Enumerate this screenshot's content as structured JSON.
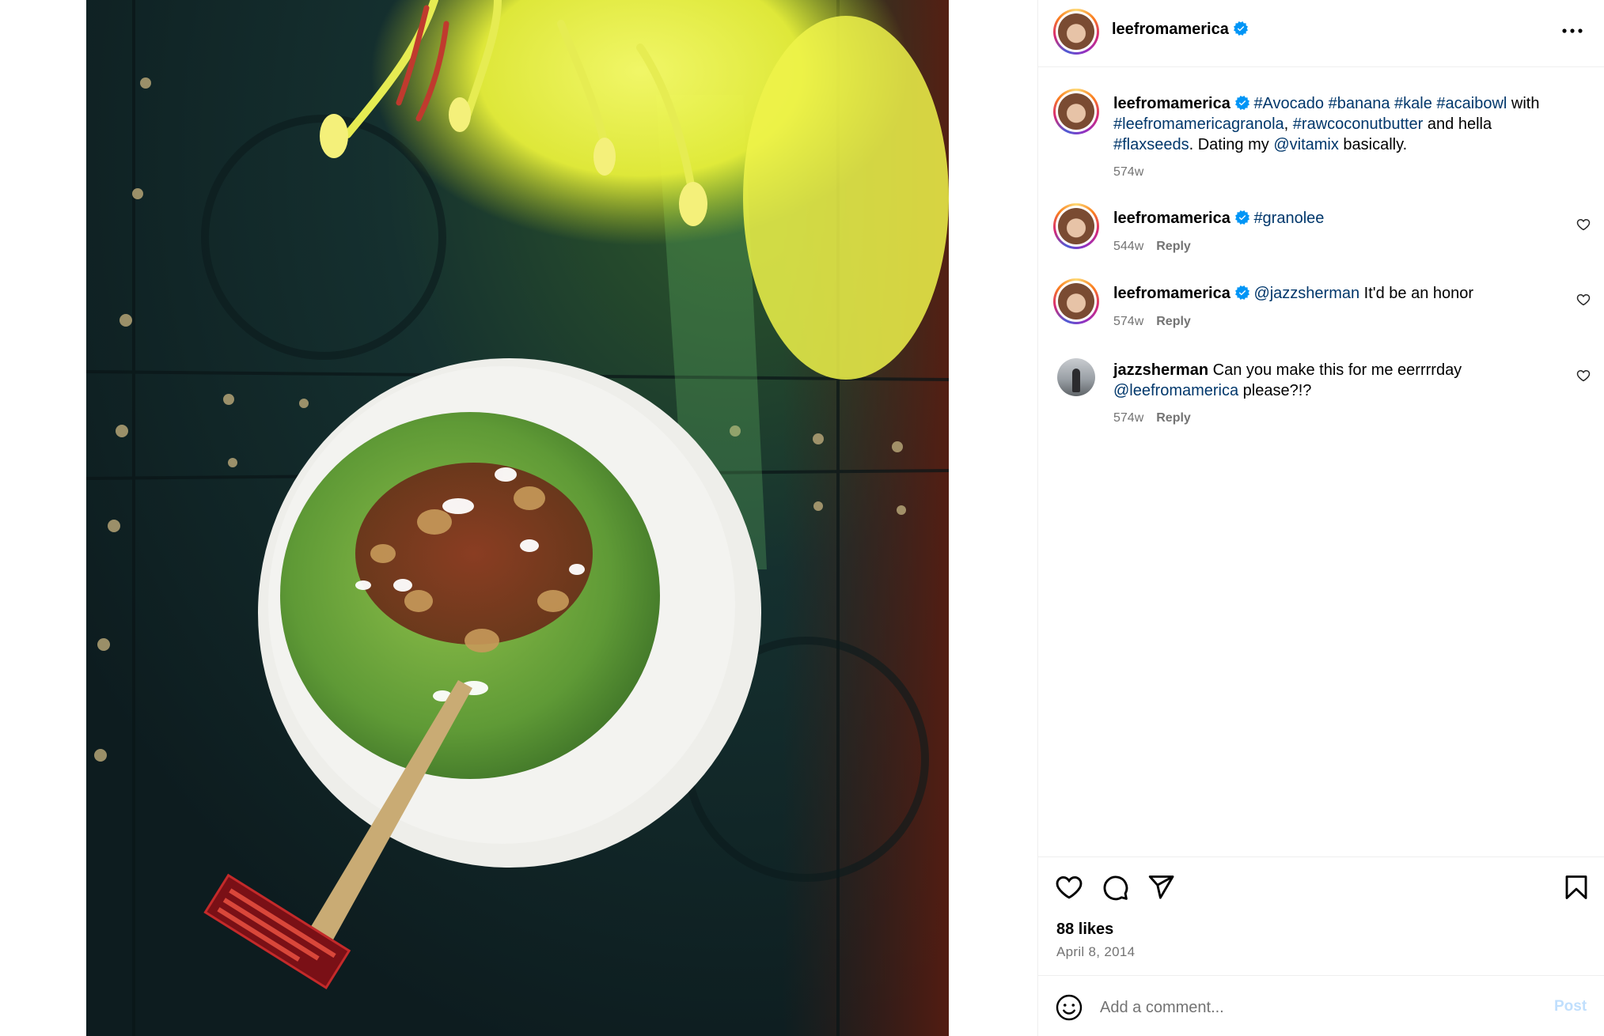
{
  "post": {
    "username": "leefromamerica",
    "verified": true,
    "more_icon": "more-horizontal-icon"
  },
  "caption": {
    "username": "leefromamerica",
    "parts": [
      {
        "text": "#Avocado",
        "type": "link"
      },
      {
        "text": " ",
        "type": "text"
      },
      {
        "text": "#banana",
        "type": "link"
      },
      {
        "text": " ",
        "type": "text"
      },
      {
        "text": "#kale",
        "type": "link"
      },
      {
        "text": " ",
        "type": "text"
      },
      {
        "text": "#acaibowl",
        "type": "link"
      },
      {
        "text": " with ",
        "type": "text"
      },
      {
        "text": "#leefromamericagranola",
        "type": "link"
      },
      {
        "text": ", ",
        "type": "text"
      },
      {
        "text": "#rawcoconutbutter",
        "type": "link"
      },
      {
        "text": " and hella ",
        "type": "text"
      },
      {
        "text": "#flaxseeds",
        "type": "link"
      },
      {
        "text": ". Dating my ",
        "type": "text"
      },
      {
        "text": "@vitamix",
        "type": "link"
      },
      {
        "text": " basically.",
        "type": "text"
      }
    ],
    "time": "574w"
  },
  "comments": [
    {
      "username": "leefromamerica",
      "verified": true,
      "parts": [
        {
          "text": "#granolee",
          "type": "link"
        }
      ],
      "time": "544w",
      "reply_label": "Reply"
    },
    {
      "username": "leefromamerica",
      "verified": true,
      "parts": [
        {
          "text": "@jazzsherman",
          "type": "link"
        },
        {
          "text": " It'd be an honor",
          "type": "text"
        }
      ],
      "time": "574w",
      "reply_label": "Reply"
    },
    {
      "username": "jazzsherman",
      "verified": false,
      "parts": [
        {
          "text": "Can you make this for me eerrrrday ",
          "type": "text"
        },
        {
          "text": "@leefromamerica",
          "type": "link"
        },
        {
          "text": " please?!?",
          "type": "text"
        }
      ],
      "time": "574w",
      "reply_label": "Reply"
    }
  ],
  "actions": {
    "icons": [
      "heart-icon",
      "comment-icon",
      "share-icon",
      "bookmark-icon"
    ]
  },
  "likes": "88 likes",
  "date": "April 8, 2014",
  "comment_box": {
    "placeholder": "Add a comment...",
    "post_label": "Post",
    "emoji_icon": "emoji-icon"
  },
  "colors": {
    "link": "#00376b",
    "muted": "#737373",
    "verified": "#0095f6",
    "post_disabled": "#c0dffd"
  }
}
